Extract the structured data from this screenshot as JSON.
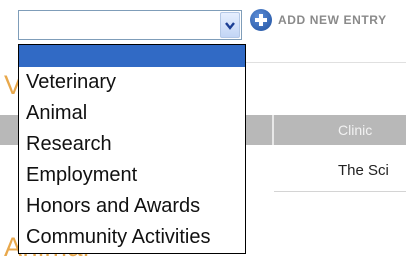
{
  "section_headings": [
    "V",
    "Animal"
  ],
  "table": {
    "column_header": "Clinic",
    "row_value": "The Sci"
  },
  "select": {
    "selected_value": "",
    "options": [
      "",
      "Veterinary",
      "Animal",
      "Research",
      "Employment",
      "Honors and Awards",
      "Community Activities"
    ]
  },
  "add_entry": {
    "label": "ADD NEW ENTRY",
    "icon": "plus-circle-icon"
  },
  "colors": {
    "highlight": "#316ac5",
    "heading": "#e8a84c",
    "table_header": "#b8b8b8",
    "add_icon": "#1d4f9e"
  }
}
